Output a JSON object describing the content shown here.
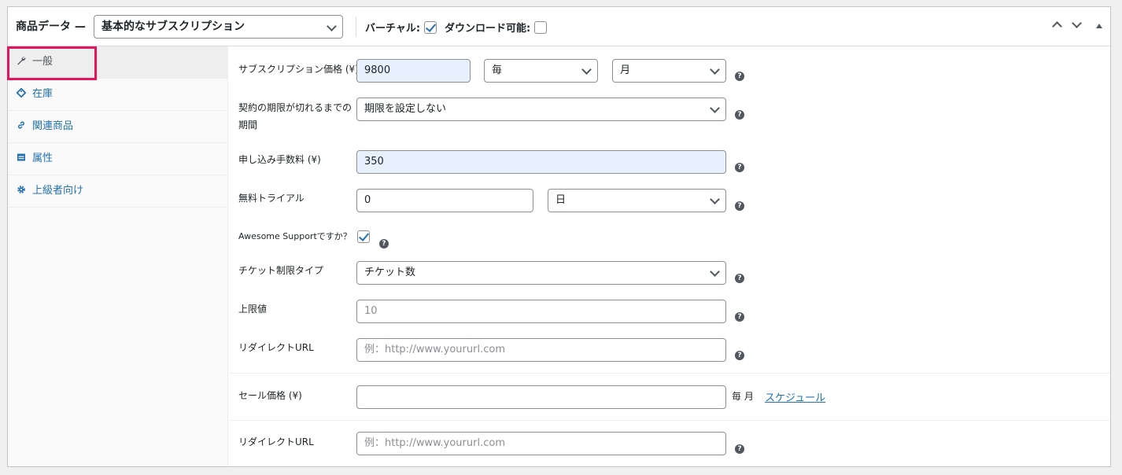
{
  "header": {
    "title": "商品データ —",
    "product_type": "基本的なサブスクリプション",
    "virtual_label": "バーチャル:",
    "virtual_checked": true,
    "downloadable_label": "ダウンロード可能:",
    "downloadable_checked": false
  },
  "tabs": [
    {
      "label": "一般",
      "icon": "wrench-icon",
      "active": true
    },
    {
      "label": "在庫",
      "icon": "tag-icon",
      "active": false
    },
    {
      "label": "関連商品",
      "icon": "link-icon",
      "active": false
    },
    {
      "label": "属性",
      "icon": "table-icon",
      "active": false
    },
    {
      "label": "上級者向け",
      "icon": "gear-icon",
      "active": false
    }
  ],
  "fields": {
    "price_label": "サブスクリプション価格 (¥)",
    "price_value": "9800",
    "period_interval": "毎",
    "period": "月",
    "length_label_line1": "契約の期限が切れるまでの",
    "length_label_line2": "期間",
    "length_value": "期限を設定しない",
    "signup_fee_label": "申し込み手数料 (¥)",
    "signup_fee_value": "350",
    "trial_label": "無料トライアル",
    "trial_value": "0",
    "trial_period": "日",
    "awesome_label": "Awesome Supportですか？",
    "awesome_checked": true,
    "ticket_limit_label": "チケット制限タイプ",
    "ticket_limit_value": "チケット数",
    "upper_limit_label": "上限値",
    "upper_limit_placeholder": "10",
    "redirect_label": "リダイレクトURL",
    "redirect_placeholder": "例：http://www.yoururl.com",
    "sale_price_label": "セール価格 (¥)",
    "sale_price_value": "",
    "sale_suffix": "毎 月",
    "schedule_link": "スケジュール",
    "redirect2_label": "リダイレクトURL",
    "redirect2_placeholder": "例：http://www.yoururl.com"
  },
  "help_glyph": "?",
  "colors": {
    "accent": "#2271b1",
    "highlight": "#e6145a",
    "autofill": "#e8f0fe"
  }
}
